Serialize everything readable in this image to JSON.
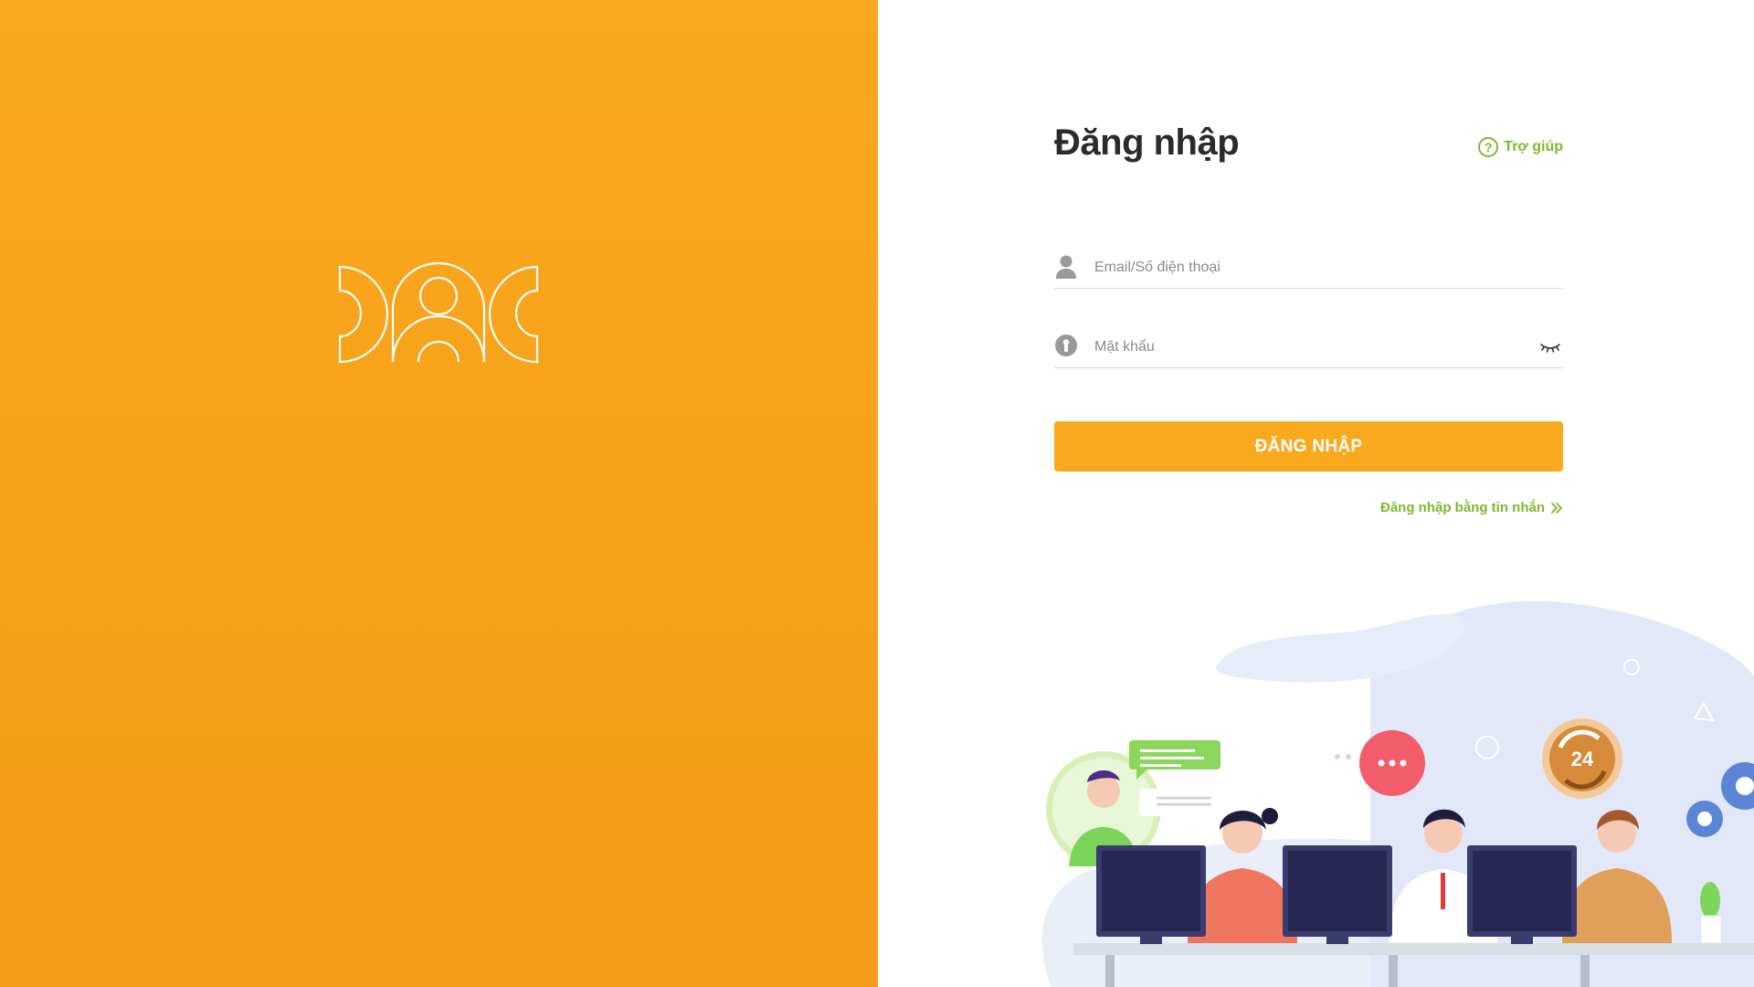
{
  "brand": {
    "logo_icon": "people-logo-outline",
    "background_color": "#f8a91d"
  },
  "login": {
    "title": "Đăng nhập",
    "help_label": "Trợ giúp",
    "help_icon": "question-circle-icon",
    "email": {
      "placeholder": "Email/Số điện thoại",
      "value": "",
      "icon": "user-icon"
    },
    "password": {
      "placeholder": "Mật khẩu",
      "value": "",
      "icon": "keyhole-icon",
      "toggle_icon": "eye-closed-icon"
    },
    "submit_label": "ĐĂNG NHẬP",
    "sms_login_label": "Đăng nhập bằng tin nhắn",
    "sms_login_icon": "double-chevron-right-icon"
  },
  "illustration": {
    "badge_text": "24"
  },
  "colors": {
    "accent": "#f8a91d",
    "link_green": "#7cb82f",
    "title": "#2b2b2b"
  }
}
